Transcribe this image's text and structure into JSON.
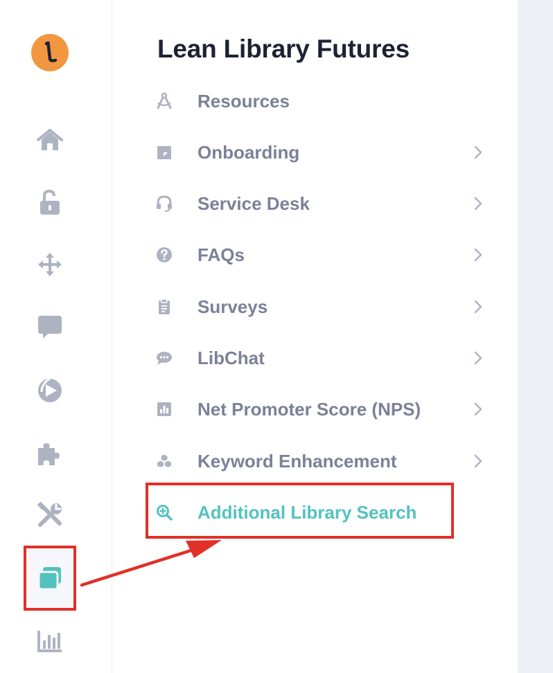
{
  "rail": {
    "logo_icon": "lean-library-logo",
    "logo_color": "#f2963f",
    "items": [
      {
        "icon": "home-icon"
      },
      {
        "icon": "unlock-icon"
      },
      {
        "icon": "move-arrows-icon"
      },
      {
        "icon": "chat-bubble-icon"
      },
      {
        "icon": "play-circle-icon"
      },
      {
        "icon": "puzzle-icon"
      },
      {
        "icon": "tools-icon"
      },
      {
        "icon": "library-stack-icon",
        "active": true
      },
      {
        "icon": "bar-chart-icon"
      }
    ]
  },
  "panel": {
    "title": "Lean Library Futures",
    "items": [
      {
        "label": "Resources",
        "icon": "compass-icon",
        "has_submenu": false
      },
      {
        "label": "Onboarding",
        "icon": "square-note-icon",
        "has_submenu": true
      },
      {
        "label": "Service Desk",
        "icon": "headset-icon",
        "has_submenu": true
      },
      {
        "label": "FAQs",
        "icon": "question-circle-icon",
        "has_submenu": true
      },
      {
        "label": "Surveys",
        "icon": "clipboard-icon",
        "has_submenu": true
      },
      {
        "label": "LibChat",
        "icon": "speech-bubble-icon",
        "has_submenu": true
      },
      {
        "label": "Net Promoter Score (NPS)",
        "icon": "chart-square-icon",
        "has_submenu": true
      },
      {
        "label": "Keyword Enhancement",
        "icon": "cubes-icon",
        "has_submenu": true
      },
      {
        "label": "Additional Library Search",
        "icon": "zoom-in-icon",
        "has_submenu": false,
        "active": true
      }
    ]
  },
  "colors": {
    "accent": "#53c2be",
    "icon_gray": "#aeb3c2",
    "text_gray": "#7b8197",
    "title": "#1d2233",
    "annotation_red": "#e03027"
  }
}
